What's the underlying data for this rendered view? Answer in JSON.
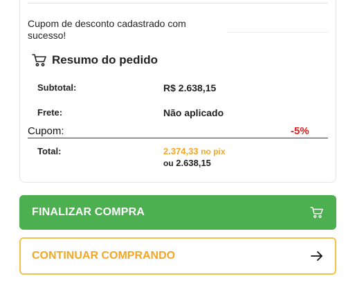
{
  "notice": {
    "message": "Cupom de desconto cadastrado com sucesso!"
  },
  "summary": {
    "title": "Resumo do pedido",
    "icon": "cart-icon",
    "subtotal_label": "Subtotal:",
    "subtotal_value": "R$ 2.638,15",
    "shipping_label": "Frete:",
    "shipping_value": "Não aplicado",
    "coupon_label": "Cupom:",
    "coupon_value": "-5%",
    "total_label": "Total:",
    "total_pix_value": "2.374,33",
    "total_pix_suffix": "no pix",
    "total_alt_prefix": "ou",
    "total_alt_value": "2.638,15"
  },
  "actions": {
    "finish_label": "FINALIZAR COMPRA",
    "finish_icon": "cart-icon",
    "continue_label": "CONTINUAR COMPRANDO",
    "continue_icon": "arrow-right-icon"
  },
  "colors": {
    "finish_bg": "#4caf50",
    "accent_orange": "#f5a623",
    "discount_red": "#e11d1d"
  }
}
